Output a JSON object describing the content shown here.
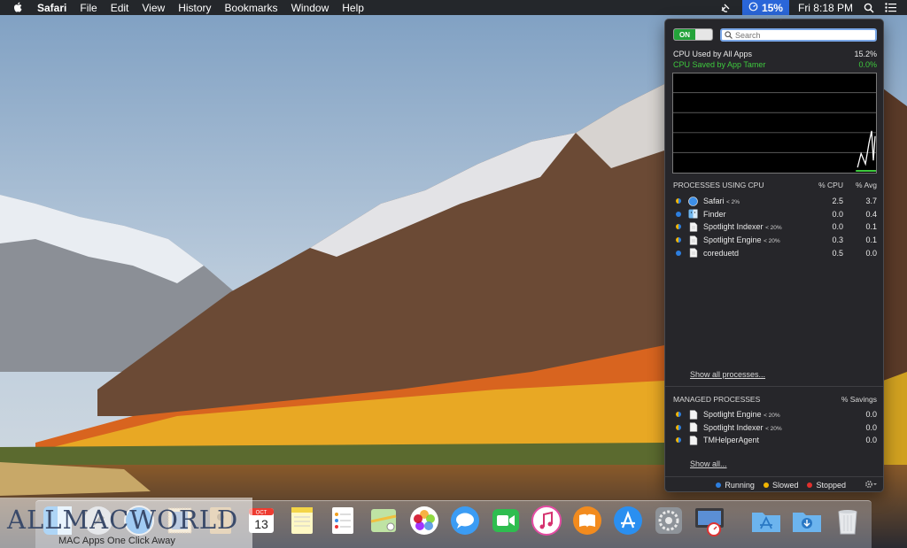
{
  "menubar": {
    "app_name": "Safari",
    "menus": [
      "File",
      "Edit",
      "View",
      "History",
      "Bookmarks",
      "Window",
      "Help"
    ],
    "tamer_percent": "15%",
    "clock": "Fri 8:18 PM"
  },
  "panel": {
    "toggle_label": "ON",
    "search_placeholder": "Search",
    "cpu_used_label": "CPU Used by All Apps",
    "cpu_used_value": "15.2%",
    "cpu_saved_label": "CPU Saved by App Tamer",
    "cpu_saved_value": "0.0%",
    "processes_header": {
      "name": "PROCESSES USING CPU",
      "cpu": "% CPU",
      "avg": "% Avg"
    },
    "processes": [
      {
        "name": "Safari",
        "limit": "< 2%",
        "cpu": "2.5",
        "avg": "3.7",
        "icon": "safari-icon",
        "paused": true
      },
      {
        "name": "Finder",
        "limit": "",
        "cpu": "0.0",
        "avg": "0.4",
        "icon": "finder-icon",
        "paused": false
      },
      {
        "name": "Spotlight Indexer",
        "limit": "< 20%",
        "cpu": "0.0",
        "avg": "0.1",
        "icon": "document-icon",
        "paused": true
      },
      {
        "name": "Spotlight Engine",
        "limit": "< 20%",
        "cpu": "0.3",
        "avg": "0.1",
        "icon": "document-icon",
        "paused": true
      },
      {
        "name": "coreduetd",
        "limit": "",
        "cpu": "0.5",
        "avg": "0.0",
        "icon": "document-icon",
        "paused": false
      }
    ],
    "show_all_processes": "Show all processes...",
    "managed_header": {
      "name": "MANAGED PROCESSES",
      "savings": "% Savings"
    },
    "managed": [
      {
        "name": "Spotlight Engine",
        "limit": "< 20%",
        "savings": "0.0"
      },
      {
        "name": "Spotlight Indexer",
        "limit": "< 20%",
        "savings": "0.0"
      },
      {
        "name": "TMHelperAgent",
        "limit": "",
        "savings": "0.0"
      }
    ],
    "show_all": "Show all...",
    "legend": [
      {
        "label": "Running",
        "color": "#2d7fe0"
      },
      {
        "label": "Slowed",
        "color": "#f0b400"
      },
      {
        "label": "Stopped",
        "color": "#e0302d"
      }
    ]
  },
  "dock": {
    "calendar_month": "OCT",
    "calendar_day": "13"
  },
  "watermark": {
    "big": "ALLMACWORLD",
    "small": "MAC Apps One Click Away"
  },
  "colors": {
    "accent": "#2a66d9",
    "toggle_on": "#23a33a",
    "saved_green": "#3ec93e"
  }
}
